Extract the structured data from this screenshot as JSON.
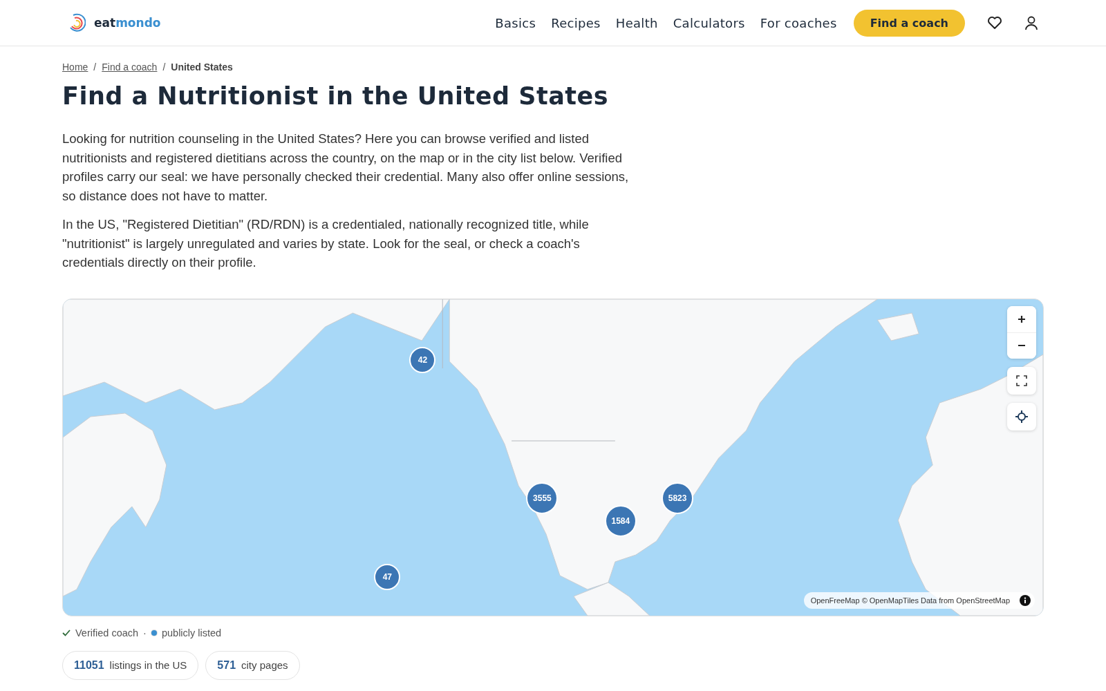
{
  "header": {
    "logo": {
      "part1": "eat",
      "part2": "mondo"
    },
    "nav": [
      "Basics",
      "Recipes",
      "Health",
      "Calculators",
      "For coaches"
    ],
    "cta": "Find a coach"
  },
  "breadcrumbs": [
    {
      "label": "Home",
      "link": true
    },
    {
      "label": "Find a coach",
      "link": true
    },
    {
      "label": "United States",
      "link": false
    }
  ],
  "breadcrumb_separators": [
    "/",
    "/"
  ],
  "title": "Find a Nutritionist in the United States",
  "paragraphs": [
    "Looking for nutrition counseling in the United States? Here you can browse verified and listed nutritionists and registered dietitians across the country, on the map or in the city list below. Verified profiles carry our seal: we have personally checked their credential. Many also offer online sessions, so distance does not have to matter.",
    "In the US, \"Registered Dietitian\" (RD/RDN) is a credentialed, nationally recognized title, while \"nutritionist\" is largely unregulated and varies by state. Look for the seal, or check a coach's credentials directly on their profile."
  ],
  "map": {
    "clusters": [
      {
        "count": "42"
      },
      {
        "count": "3555"
      },
      {
        "count": "1584"
      },
      {
        "count": "5823"
      },
      {
        "count": "47"
      }
    ],
    "attribution": "OpenFreeMap © OpenMapTiles Data from OpenStreetMap"
  },
  "legend": {
    "verified": "Verified coach",
    "separator": "·",
    "listed": "publicly listed"
  },
  "stats": [
    {
      "value": "11051",
      "label": "listings in the US"
    },
    {
      "value": "571",
      "label": "city pages"
    }
  ]
}
